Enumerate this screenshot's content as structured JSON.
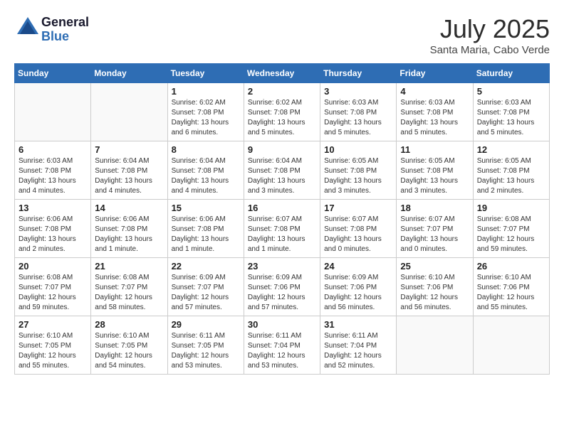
{
  "header": {
    "logo_general": "General",
    "logo_blue": "Blue",
    "month": "July 2025",
    "location": "Santa Maria, Cabo Verde"
  },
  "weekdays": [
    "Sunday",
    "Monday",
    "Tuesday",
    "Wednesday",
    "Thursday",
    "Friday",
    "Saturday"
  ],
  "weeks": [
    [
      {
        "day": "",
        "info": ""
      },
      {
        "day": "",
        "info": ""
      },
      {
        "day": "1",
        "info": "Sunrise: 6:02 AM\nSunset: 7:08 PM\nDaylight: 13 hours and 6 minutes."
      },
      {
        "day": "2",
        "info": "Sunrise: 6:02 AM\nSunset: 7:08 PM\nDaylight: 13 hours and 5 minutes."
      },
      {
        "day": "3",
        "info": "Sunrise: 6:03 AM\nSunset: 7:08 PM\nDaylight: 13 hours and 5 minutes."
      },
      {
        "day": "4",
        "info": "Sunrise: 6:03 AM\nSunset: 7:08 PM\nDaylight: 13 hours and 5 minutes."
      },
      {
        "day": "5",
        "info": "Sunrise: 6:03 AM\nSunset: 7:08 PM\nDaylight: 13 hours and 5 minutes."
      }
    ],
    [
      {
        "day": "6",
        "info": "Sunrise: 6:03 AM\nSunset: 7:08 PM\nDaylight: 13 hours and 4 minutes."
      },
      {
        "day": "7",
        "info": "Sunrise: 6:04 AM\nSunset: 7:08 PM\nDaylight: 13 hours and 4 minutes."
      },
      {
        "day": "8",
        "info": "Sunrise: 6:04 AM\nSunset: 7:08 PM\nDaylight: 13 hours and 4 minutes."
      },
      {
        "day": "9",
        "info": "Sunrise: 6:04 AM\nSunset: 7:08 PM\nDaylight: 13 hours and 3 minutes."
      },
      {
        "day": "10",
        "info": "Sunrise: 6:05 AM\nSunset: 7:08 PM\nDaylight: 13 hours and 3 minutes."
      },
      {
        "day": "11",
        "info": "Sunrise: 6:05 AM\nSunset: 7:08 PM\nDaylight: 13 hours and 3 minutes."
      },
      {
        "day": "12",
        "info": "Sunrise: 6:05 AM\nSunset: 7:08 PM\nDaylight: 13 hours and 2 minutes."
      }
    ],
    [
      {
        "day": "13",
        "info": "Sunrise: 6:06 AM\nSunset: 7:08 PM\nDaylight: 13 hours and 2 minutes."
      },
      {
        "day": "14",
        "info": "Sunrise: 6:06 AM\nSunset: 7:08 PM\nDaylight: 13 hours and 1 minute."
      },
      {
        "day": "15",
        "info": "Sunrise: 6:06 AM\nSunset: 7:08 PM\nDaylight: 13 hours and 1 minute."
      },
      {
        "day": "16",
        "info": "Sunrise: 6:07 AM\nSunset: 7:08 PM\nDaylight: 13 hours and 1 minute."
      },
      {
        "day": "17",
        "info": "Sunrise: 6:07 AM\nSunset: 7:08 PM\nDaylight: 13 hours and 0 minutes."
      },
      {
        "day": "18",
        "info": "Sunrise: 6:07 AM\nSunset: 7:07 PM\nDaylight: 13 hours and 0 minutes."
      },
      {
        "day": "19",
        "info": "Sunrise: 6:08 AM\nSunset: 7:07 PM\nDaylight: 12 hours and 59 minutes."
      }
    ],
    [
      {
        "day": "20",
        "info": "Sunrise: 6:08 AM\nSunset: 7:07 PM\nDaylight: 12 hours and 59 minutes."
      },
      {
        "day": "21",
        "info": "Sunrise: 6:08 AM\nSunset: 7:07 PM\nDaylight: 12 hours and 58 minutes."
      },
      {
        "day": "22",
        "info": "Sunrise: 6:09 AM\nSunset: 7:07 PM\nDaylight: 12 hours and 57 minutes."
      },
      {
        "day": "23",
        "info": "Sunrise: 6:09 AM\nSunset: 7:06 PM\nDaylight: 12 hours and 57 minutes."
      },
      {
        "day": "24",
        "info": "Sunrise: 6:09 AM\nSunset: 7:06 PM\nDaylight: 12 hours and 56 minutes."
      },
      {
        "day": "25",
        "info": "Sunrise: 6:10 AM\nSunset: 7:06 PM\nDaylight: 12 hours and 56 minutes."
      },
      {
        "day": "26",
        "info": "Sunrise: 6:10 AM\nSunset: 7:06 PM\nDaylight: 12 hours and 55 minutes."
      }
    ],
    [
      {
        "day": "27",
        "info": "Sunrise: 6:10 AM\nSunset: 7:05 PM\nDaylight: 12 hours and 55 minutes."
      },
      {
        "day": "28",
        "info": "Sunrise: 6:10 AM\nSunset: 7:05 PM\nDaylight: 12 hours and 54 minutes."
      },
      {
        "day": "29",
        "info": "Sunrise: 6:11 AM\nSunset: 7:05 PM\nDaylight: 12 hours and 53 minutes."
      },
      {
        "day": "30",
        "info": "Sunrise: 6:11 AM\nSunset: 7:04 PM\nDaylight: 12 hours and 53 minutes."
      },
      {
        "day": "31",
        "info": "Sunrise: 6:11 AM\nSunset: 7:04 PM\nDaylight: 12 hours and 52 minutes."
      },
      {
        "day": "",
        "info": ""
      },
      {
        "day": "",
        "info": ""
      }
    ]
  ]
}
